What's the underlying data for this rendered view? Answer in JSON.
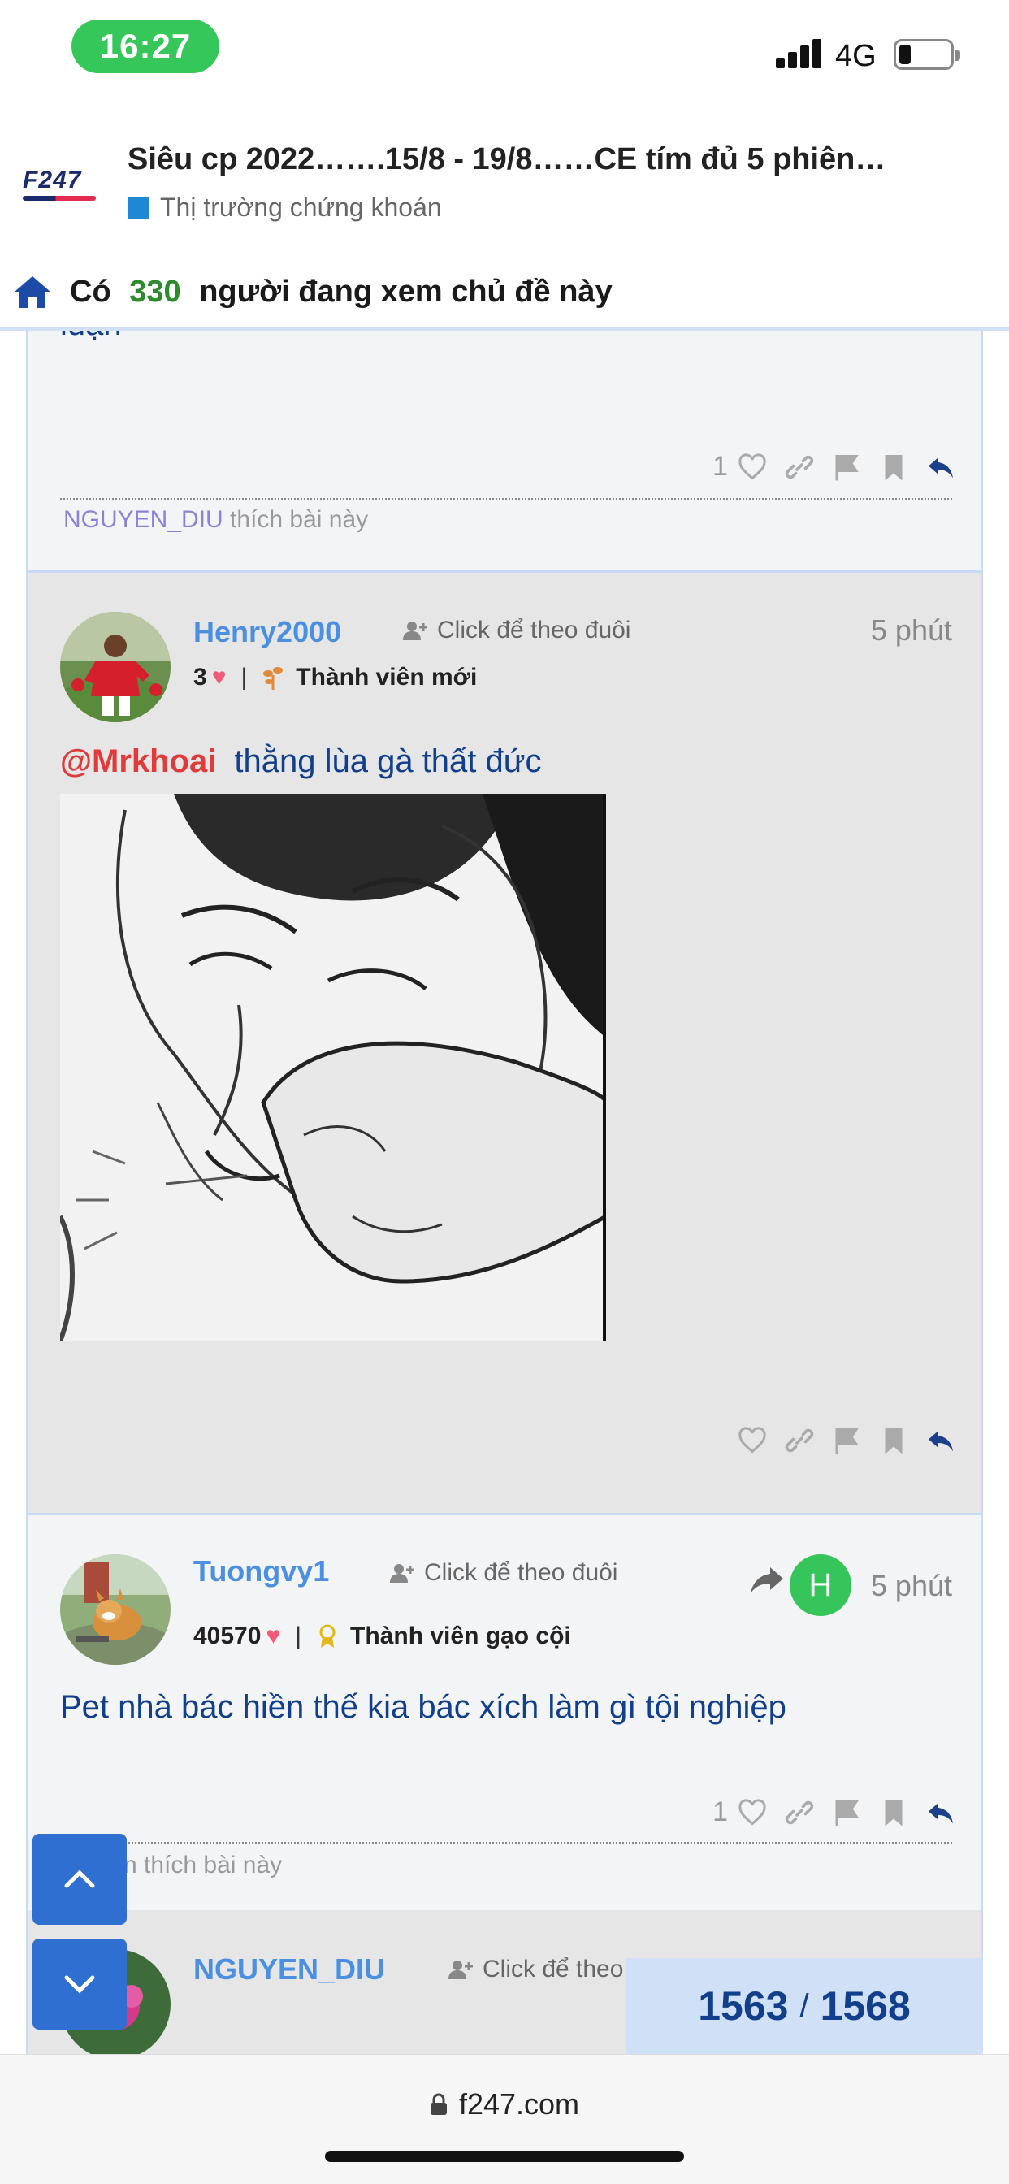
{
  "status_bar": {
    "time": "16:27",
    "network": "4G"
  },
  "thread": {
    "logo": "F247",
    "title": "Siêu cp 2022…….15/8 - 19/8……CE tím đủ 5 phiên…",
    "category": "Thị trường chứng khoán",
    "category_color": "#1e88d7"
  },
  "viewers": {
    "prefix": "Có",
    "count": "330",
    "suffix": "người đang xem chủ đề này"
  },
  "posts": [
    {
      "cut_text": "luận",
      "like_count": "1",
      "liked_by_user": "NGUYEN_DIU",
      "liked_by_suffix": "thích bài này"
    },
    {
      "username": "Henry2000",
      "follow_label": "Click để theo đuôi",
      "time": "5 phút",
      "hearts": "3",
      "rank": "Thành viên mới",
      "mention": "@Mrkhoai",
      "text": "thằng lùa gà thất đức"
    },
    {
      "username": "Tuongvy1",
      "follow_label": "Click để theo đuôi",
      "reply_avatar_letter": "H",
      "time": "5 phút",
      "hearts": "40570",
      "rank": "Thành viên gạo cội",
      "text": "Pet nhà bác hiền thế kia bác xích làm gì tội nghiệp",
      "like_count": "1",
      "liked_by_suffix": "n thích bài này"
    },
    {
      "username": "NGUYEN_DIU",
      "follow_label": "Click để theo"
    }
  ],
  "pager": {
    "current": "1563",
    "total": "1568"
  },
  "browser": {
    "url": "f247.com"
  },
  "colors": {
    "accent": "#2f6fd1",
    "link": "#4a8fe0",
    "content": "#123f8c",
    "mention": "#e03b3b",
    "online": "#36c55a"
  }
}
